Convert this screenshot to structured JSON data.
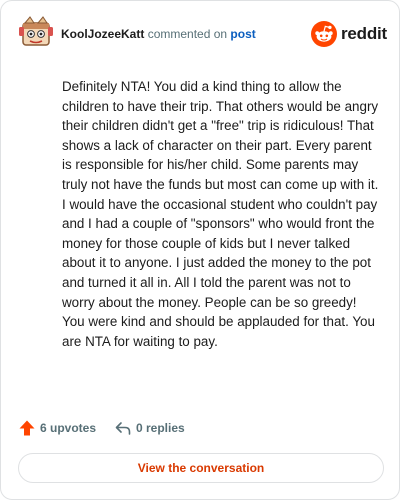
{
  "comment": {
    "username": "KoolJozeeKatt",
    "action": "commented on",
    "target": "post",
    "body": "Definitely NTA! You did a kind thing to allow the children to have their trip. That others would be angry their children didn't get a \"free\" trip is ridiculous! That shows a lack of character on their part. Every parent is responsible for his/her child. Some parents may truly not have the funds but most can come up with it. I would have the occasional student who couldn't pay and I had a couple of \"sponsors\" who would front the money for those couple of kids but I never talked about it to anyone. I just added the money to the pot and turned it all in. All I told the parent was not to worry about the money. People can be so greedy! You were kind and should be applauded for that. You are NTA for waiting to pay."
  },
  "brand": {
    "wordmark": "reddit",
    "icon": "reddit-snoo-icon",
    "color": "#ff4500"
  },
  "stats": {
    "upvotes": "6 upvotes",
    "upvote_icon": "upvote-arrow-icon",
    "upvote_color": "#ff4500",
    "replies": "0 replies",
    "reply_icon": "reply-arrow-icon"
  },
  "cta": {
    "label": "View the conversation",
    "color": "#d93900"
  },
  "avatar": {
    "icon": "snoo-avatar-icon"
  }
}
